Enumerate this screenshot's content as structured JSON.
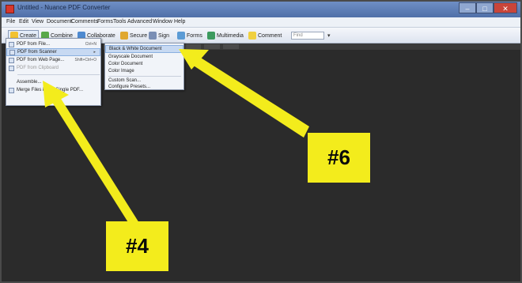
{
  "window": {
    "title": "Untitled - Nuance PDF Converter",
    "controls": {
      "minimize": "–",
      "maximize": "□",
      "close": "✕"
    }
  },
  "menubar": {
    "items": [
      "File",
      "Edit",
      "View",
      "Document",
      "Comments",
      "Forms",
      "Tools",
      "Advanced",
      "Window",
      "Help"
    ]
  },
  "toolbar": {
    "create": "Create",
    "combine": "Combine",
    "collaborate": "Collaborate",
    "secure": "Secure",
    "sign": "Sign",
    "forms": "Forms",
    "multimedia": "Multimedia",
    "comment": "Comment",
    "find_placeholder": "Find"
  },
  "create_menu": {
    "items": [
      {
        "label": "PDF from File...",
        "shortcut": "Ctrl+N",
        "state": "normal"
      },
      {
        "label": "PDF from Scanner",
        "shortcut": "",
        "state": "highlight"
      },
      {
        "label": "PDF from Web Page...",
        "shortcut": "Shift+Ctrl+O",
        "state": "normal"
      },
      {
        "label": "PDF from Clipboard",
        "shortcut": "",
        "state": "disabled"
      },
      {
        "label": "Assemble...",
        "shortcut": "",
        "state": "normal"
      },
      {
        "label": "Merge Files into a Single PDF...",
        "shortcut": "",
        "state": "normal"
      }
    ]
  },
  "scanner_submenu": {
    "items": [
      {
        "label": "Black & White Document",
        "state": "highlight"
      },
      {
        "label": "Grayscale Document",
        "state": "normal"
      },
      {
        "label": "Color Document",
        "state": "normal"
      },
      {
        "label": "Color Image",
        "state": "normal"
      },
      {
        "label": "Custom Scan...",
        "state": "normal"
      },
      {
        "label": "Configure Presets...",
        "state": "normal"
      }
    ]
  },
  "annotations": {
    "label_6": "#6",
    "label_4": "#4",
    "color": "#f3ec1c"
  }
}
